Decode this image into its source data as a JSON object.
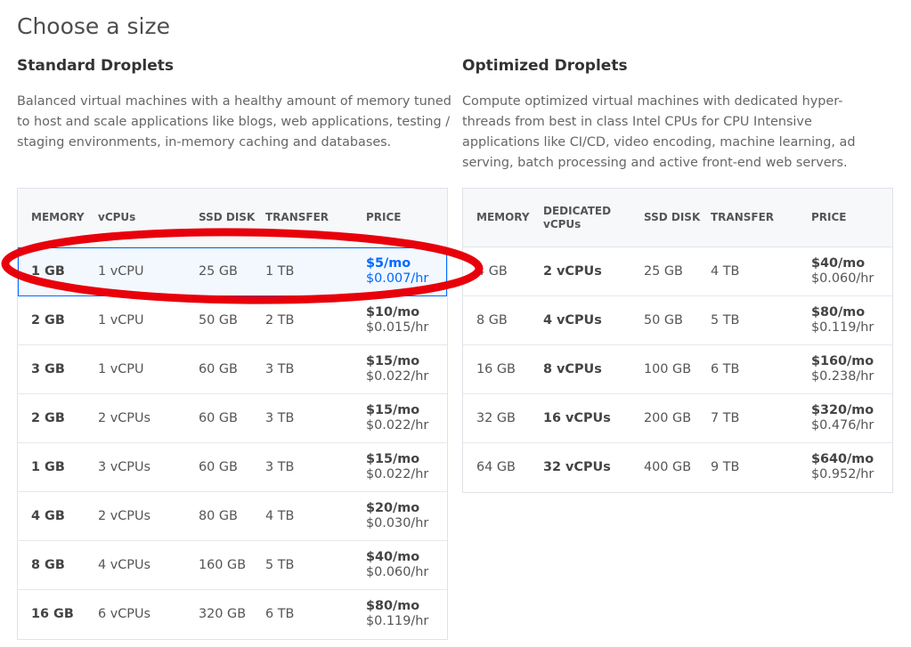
{
  "page": {
    "title": "Choose a size"
  },
  "standard": {
    "title": "Standard Droplets",
    "description": "Balanced virtual machines with a healthy amount of memory tuned to host and scale applications like blogs, web applications, testing / staging environments, in-memory caching and databases.",
    "columns": [
      "MEMORY",
      "vCPUs",
      "SSD DISK",
      "TRANSFER",
      "PRICE"
    ],
    "rows": [
      {
        "memory": "1 GB",
        "vcpus": "1 vCPU",
        "disk": "25 GB",
        "transfer": "1 TB",
        "price_mo": "$5/mo",
        "price_hr": "$0.007/hr"
      },
      {
        "memory": "2 GB",
        "vcpus": "1 vCPU",
        "disk": "50 GB",
        "transfer": "2 TB",
        "price_mo": "$10/mo",
        "price_hr": "$0.015/hr"
      },
      {
        "memory": "3 GB",
        "vcpus": "1 vCPU",
        "disk": "60 GB",
        "transfer": "3 TB",
        "price_mo": "$15/mo",
        "price_hr": "$0.022/hr"
      },
      {
        "memory": "2 GB",
        "vcpus": "2 vCPUs",
        "disk": "60 GB",
        "transfer": "3 TB",
        "price_mo": "$15/mo",
        "price_hr": "$0.022/hr"
      },
      {
        "memory": "1 GB",
        "vcpus": "3 vCPUs",
        "disk": "60 GB",
        "transfer": "3 TB",
        "price_mo": "$15/mo",
        "price_hr": "$0.022/hr"
      },
      {
        "memory": "4 GB",
        "vcpus": "2 vCPUs",
        "disk": "80 GB",
        "transfer": "4 TB",
        "price_mo": "$20/mo",
        "price_hr": "$0.030/hr"
      },
      {
        "memory": "8 GB",
        "vcpus": "4 vCPUs",
        "disk": "160 GB",
        "transfer": "5 TB",
        "price_mo": "$40/mo",
        "price_hr": "$0.060/hr"
      },
      {
        "memory": "16 GB",
        "vcpus": "6 vCPUs",
        "disk": "320 GB",
        "transfer": "6 TB",
        "price_mo": "$80/mo",
        "price_hr": "$0.119/hr"
      }
    ]
  },
  "optimized": {
    "title": "Optimized Droplets",
    "description": "Compute optimized virtual machines with dedicated hyper-threads from best in class Intel CPUs for CPU Intensive applications like CI/CD, video encoding, machine learning, ad serving, batch processing and active front-end web servers.",
    "columns": [
      "MEMORY",
      "DEDICATED vCPUs",
      "SSD DISK",
      "TRANSFER",
      "PRICE"
    ],
    "rows": [
      {
        "memory": "4 GB",
        "vcpus": "2 vCPUs",
        "disk": "25 GB",
        "transfer": "4 TB",
        "price_mo": "$40/mo",
        "price_hr": "$0.060/hr"
      },
      {
        "memory": "8 GB",
        "vcpus": "4 vCPUs",
        "disk": "50 GB",
        "transfer": "5 TB",
        "price_mo": "$80/mo",
        "price_hr": "$0.119/hr"
      },
      {
        "memory": "16 GB",
        "vcpus": "8 vCPUs",
        "disk": "100 GB",
        "transfer": "6 TB",
        "price_mo": "$160/mo",
        "price_hr": "$0.238/hr"
      },
      {
        "memory": "32 GB",
        "vcpus": "16 vCPUs",
        "disk": "200 GB",
        "transfer": "7 TB",
        "price_mo": "$320/mo",
        "price_hr": "$0.476/hr"
      },
      {
        "memory": "64 GB",
        "vcpus": "32 vCPUs",
        "disk": "400 GB",
        "transfer": "9 TB",
        "price_mo": "$640/mo",
        "price_hr": "$0.952/hr"
      }
    ]
  },
  "colors": {
    "accent": "#0069ff",
    "annotation": "#e8000b",
    "border": "#dfe3e8",
    "header_bg": "#f7f8fa"
  }
}
